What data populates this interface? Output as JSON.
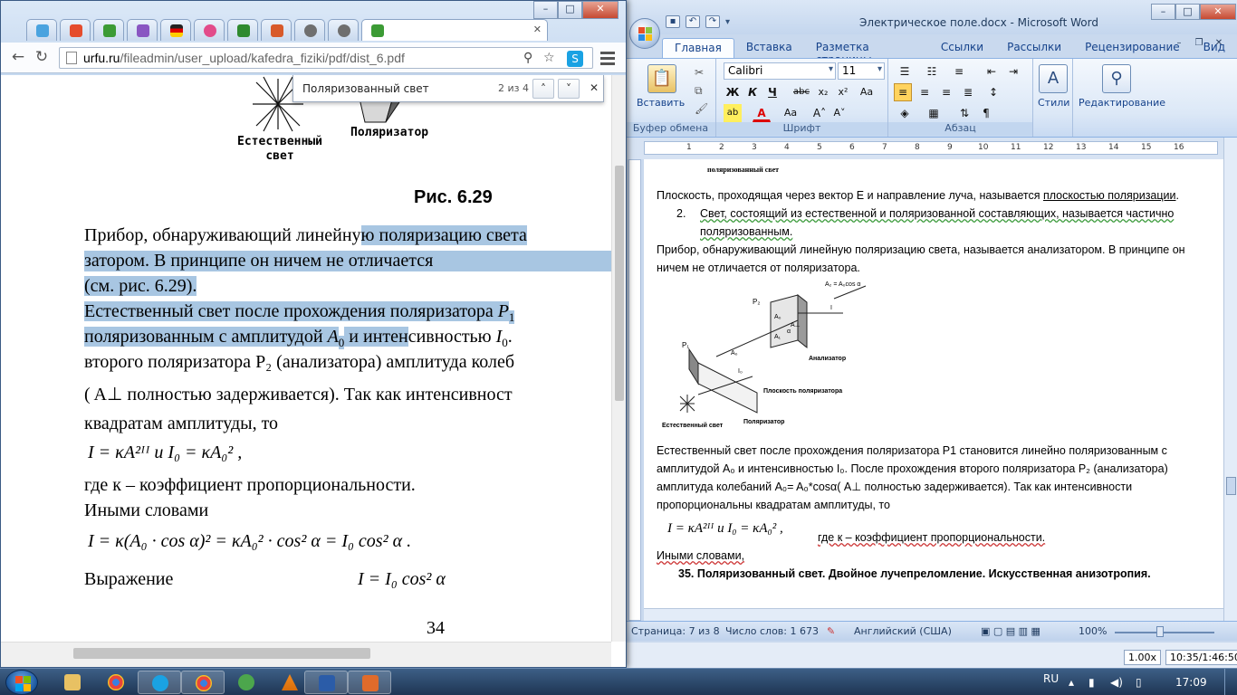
{
  "word": {
    "title": "Электрическое поле.docx - Microsoft Word",
    "tabs": [
      "Главная",
      "Вставка",
      "Разметка страницы",
      "Ссылки",
      "Рассылки",
      "Рецензирование",
      "Вид"
    ],
    "font_name": "Calibri",
    "font_size": "11",
    "groups": {
      "clipboard": "Буфер обмена",
      "font": "Шрифт",
      "paragraph": "Абзац",
      "styles": "Стили",
      "editing": "Редактирование",
      "paste": "Вставить"
    },
    "ruler_numbers": [
      "1",
      "2",
      "3",
      "4",
      "5",
      "6",
      "7",
      "8",
      "9",
      "10",
      "11",
      "12",
      "13",
      "14",
      "15",
      "16"
    ],
    "doc": {
      "fig_top_label": "поляризованный свет",
      "p1": "Плоскость, проходящая через вектор  E и направление луча, называется ",
      "p1_link": "плоскостью поляризации",
      "p1_end": ".",
      "item2_num": "2.",
      "item2": "Свет, состоящий из естественной и поляризованной составляющих, называется частично поляризованным.",
      "p2": "Прибор, обнаруживающий линейную поляризацию света,  называется анализатором. В принципе он ничем не отличается от поляризатора.",
      "fig_labels": {
        "a2": "A₂ = A₀cos α",
        "p2": "P₂",
        "p1": "P₁",
        "a0": "A₀",
        "a1": "A₁",
        "a_perp": "A⊥",
        "i0": "I₀",
        "i": "I",
        "alpha": "α",
        "analyzer": "Анализатор",
        "plane": "Плоскость поляризатора",
        "polarizer": "Поляризатор",
        "natural": "Естественный свет"
      },
      "p3": "Естественный свет после прохождения поляризатора P1 становится линейно поляризованным с амплитудой A₀ и интенсивностью I₀. После прохождения второго поляризатора  P₂ (анализатора) амплитуда колебаний  A₀= A₀*cosα( A⊥ полностью задерживается). Так как интенсивности пропорциональны квадратам амплитуды, то",
      "formula": "I = κA²ᴵᴵ  и  I₀ = κA₀² ,",
      "formula_note": "где к – коэффициент пропорциональности.",
      "p4": "Иными словами,",
      "heading": "35.  Поляризованный свет. Двойное лучепреломление. Искусственная анизотропия."
    },
    "status": {
      "page": "Страница: 7 из 8",
      "words": "Число слов: 1 673",
      "lang": "Английский (США)",
      "zoom": "100%"
    },
    "bottom": {
      "speed": "1.00x",
      "time": "10:35/1:46:50"
    }
  },
  "chrome": {
    "url_host": "urfu.ru",
    "url_path": "/fileadmin/user_upload/kafedra_fiziki/pdf/dist_6.pdf",
    "find_query": "Поляризованный свет",
    "find_count": "2 из 4",
    "pdf": {
      "label_natural": "Естественный свет",
      "label_polarizer": "Поляризатор",
      "caption": "Рис. 6.29",
      "l1a": "Прибор, обнаруживающий линейну",
      "l1b": "ю поляризацию света",
      "l2": "затором.  В  принципе  он  ничем  не  отличается",
      "l3": "(см. рис. 6.29).",
      "l4a": "Естественный свет после прохождения поляризатора ",
      "l4b": "P",
      "l4c": "1",
      "l5a": "поляризованным с амплитудой ",
      "l5b": "A",
      "l5c": "0",
      "l5d": " и интен",
      "l5e": "сивностью ",
      "l5f": "I",
      "l5g": "0",
      "l5h": ".",
      "l6": "второго поляризатора P₂ (анализатора) амплитуда колеб",
      "l7": "( A⊥   полностью  задерживается).  Так  как  интенсивност",
      "l8": "квадратам амплитуды, то",
      "l9": "I = κA²ᴵᴵ  и  I₀ = κA₀² ,",
      "l10": "где к – коэффициент пропорциональности.",
      "l11": "Иными словами",
      "l12": "I = κ(A₀ · cos α)² = κA₀² · cos² α = I₀ cos² α .",
      "l13a": "Выражение",
      "l13b": "I = I₀ cos² α",
      "page_num": "34"
    }
  },
  "taskbar": {
    "lang": "RU",
    "clock": "17:09"
  },
  "colors": {
    "selection": "#a8c6e2",
    "word_blue": "#15428b",
    "taskbar": "#1e3553"
  }
}
